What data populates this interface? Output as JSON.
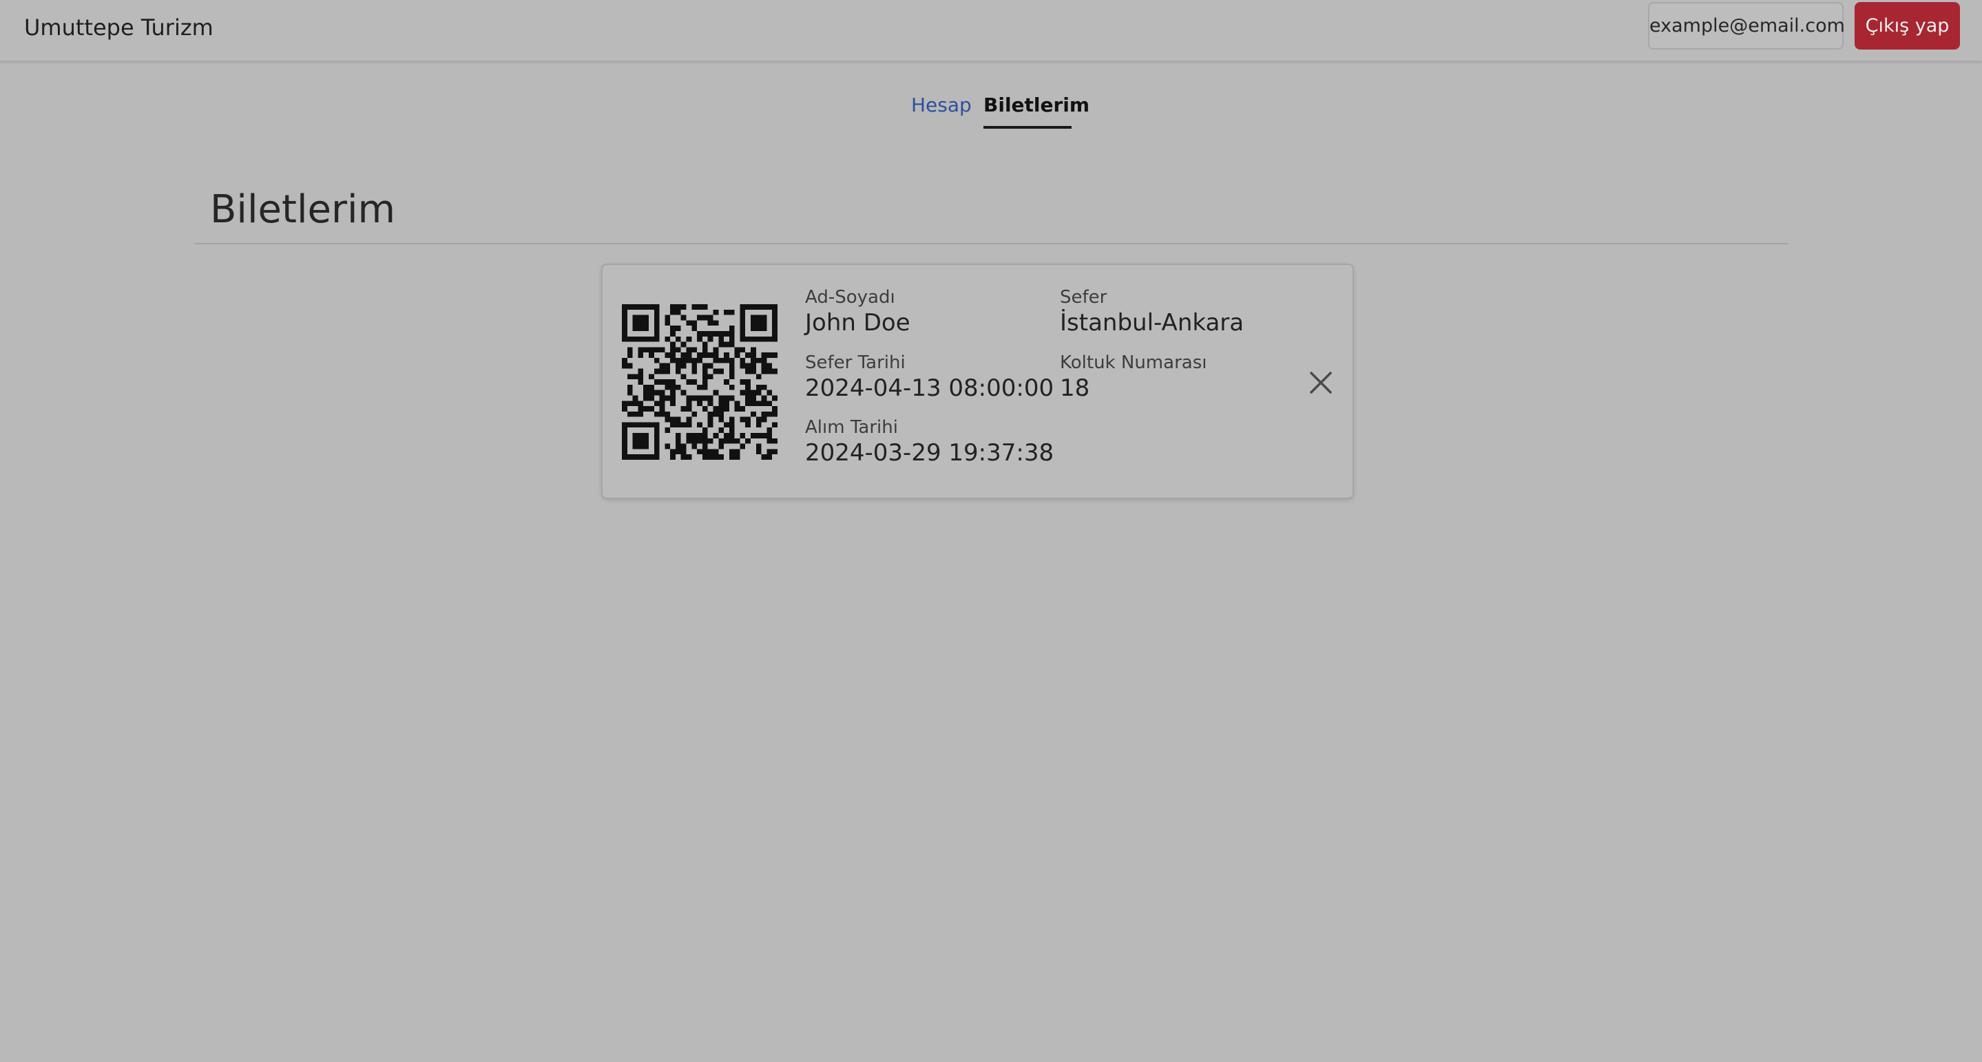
{
  "navbar": {
    "brand": "Umuttepe Turizm",
    "email": "example@email.com",
    "logout_label": "Çıkış yap"
  },
  "tabs": [
    {
      "label": "Hesap",
      "active": false
    },
    {
      "label": "Biletlerim",
      "active": true
    }
  ],
  "page": {
    "title": "Biletlerim"
  },
  "ticket": {
    "name_label": "Ad-Soyadı",
    "name_value": "John Doe",
    "route_label": "Sefer",
    "route_value": "İstanbul-Ankara",
    "trip_date_label": "Sefer Tarihi",
    "trip_date_value": "2024-04-13 08:00:00",
    "seat_label": "Koltuk Numarası",
    "seat_value": "18",
    "purchase_date_label": "Alım Tarihi",
    "purchase_date_value": "2024-03-29 19:37:38",
    "qr_icon": "qr-code-icon",
    "close_icon": "close-icon"
  },
  "colors": {
    "background": "#b9b9b9",
    "link": "#2c4fa0",
    "danger": "#a82632"
  }
}
